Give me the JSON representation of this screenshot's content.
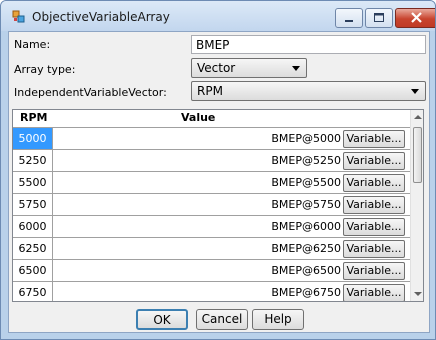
{
  "window": {
    "title": "ObjectiveVariableArray"
  },
  "form": {
    "name_label": "Name:",
    "name_value": "BMEP",
    "array_type_label": "Array type:",
    "array_type_value": "Vector",
    "ivv_label": "IndependentVariableVector:",
    "ivv_value": "RPM"
  },
  "grid": {
    "headers": {
      "rpm": "RPM",
      "value": "Value"
    },
    "button_label": "Variable...",
    "rows": [
      {
        "rpm": "5000",
        "value": "BMEP@5000",
        "selected": true
      },
      {
        "rpm": "5250",
        "value": "BMEP@5250"
      },
      {
        "rpm": "5500",
        "value": "BMEP@5500"
      },
      {
        "rpm": "5750",
        "value": "BMEP@5750"
      },
      {
        "rpm": "6000",
        "value": "BMEP@6000"
      },
      {
        "rpm": "6250",
        "value": "BMEP@6250"
      },
      {
        "rpm": "6500",
        "value": "BMEP@6500"
      },
      {
        "rpm": "6750",
        "value": "BMEP@6750"
      }
    ]
  },
  "buttons": {
    "ok": "OK",
    "cancel": "Cancel",
    "help": "Help"
  },
  "colors": {
    "selection": "#3399ff",
    "titlebar": "#c2d6ee",
    "close": "#c8442e"
  },
  "icons": [
    "app-icon",
    "minimize-icon",
    "maximize-icon",
    "close-icon",
    "dropdown-arrow-icon",
    "scroll-up-icon",
    "scroll-down-icon"
  ]
}
